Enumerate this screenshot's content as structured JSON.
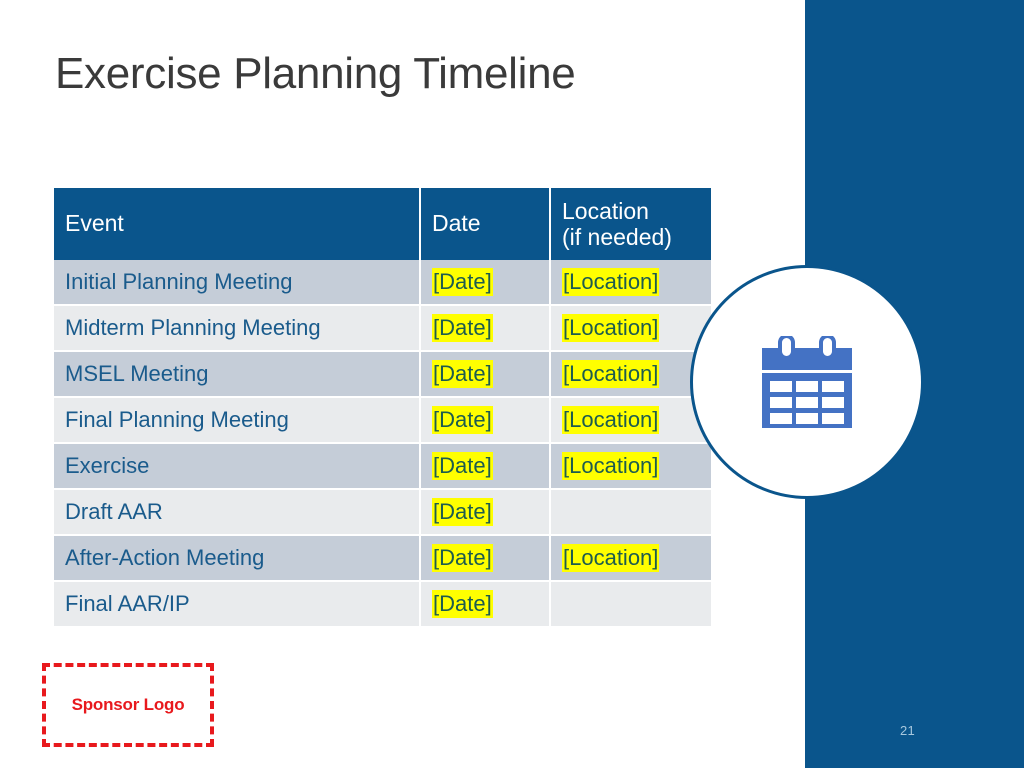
{
  "slide": {
    "title": "Exercise Planning Timeline",
    "page_number": "21",
    "background_color": "#ffffff",
    "accent_color": "#0a558c"
  },
  "table": {
    "headers": {
      "event": "Event",
      "date": "Date",
      "location_line1": "Location",
      "location_line2": "(if needed)"
    },
    "header_bg": "#0a558c",
    "header_text_color": "#ffffff",
    "row_bg_odd": "#c5cdd8",
    "row_bg_even": "#e9ebed",
    "row_text_color": "#1a5b8c",
    "highlight_bg": "#ffff00",
    "highlight_text_color": "#1d5c4f",
    "rows": [
      {
        "event": "Initial Planning Meeting",
        "date": "[Date]",
        "location": "[Location]"
      },
      {
        "event": "Midterm Planning Meeting",
        "date": "[Date]",
        "location": "[Location]"
      },
      {
        "event": "MSEL Meeting",
        "date": "[Date]",
        "location": "[Location]"
      },
      {
        "event": "Final Planning Meeting",
        "date": "[Date]",
        "location": "[Location]"
      },
      {
        "event": "Exercise",
        "date": "[Date]",
        "location": "[Location]"
      },
      {
        "event": "Draft AAR",
        "date": "[Date]",
        "location": ""
      },
      {
        "event": "After-Action Meeting",
        "date": "[Date]",
        "location": "[Location]"
      },
      {
        "event": "Final AAR/IP",
        "date": "[Date]",
        "location": ""
      }
    ]
  },
  "badge": {
    "icon_name": "calendar-icon",
    "icon_color": "#4472c4",
    "circle_border_color": "#0a558c",
    "circle_fill_color": "#ffffff"
  },
  "sponsor": {
    "label": "Sponsor Logo",
    "border_color": "#e8191d",
    "text_color": "#e8191d"
  }
}
